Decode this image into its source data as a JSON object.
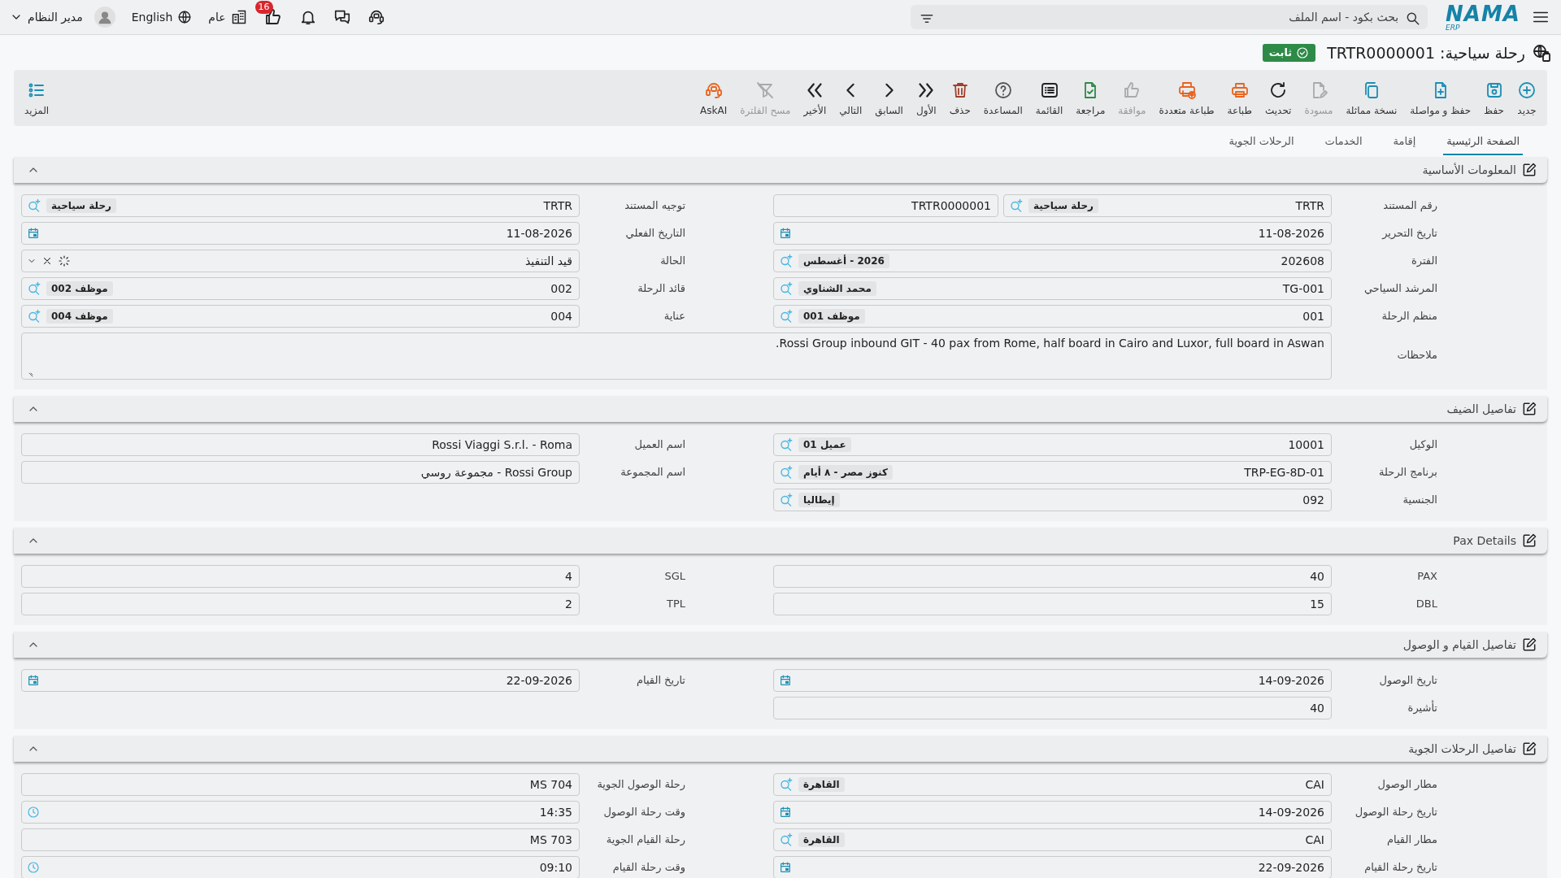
{
  "top_bar": {
    "logo": {
      "text": "NAMA",
      "sub": "ERP"
    },
    "search": {
      "placeholder": "بحث بكود - اسم الملف"
    },
    "approvals_count": "16",
    "branch": "عام",
    "language": "English",
    "user": "مدير النظام"
  },
  "document": {
    "title": "رحلة سياحية: TRTR0000001",
    "status": "ثابت"
  },
  "toolbar": {
    "buttons": [
      {
        "label": "جديد",
        "disabled": false
      },
      {
        "label": "حفظ",
        "disabled": false
      },
      {
        "label": "حفظ و مواصلة",
        "disabled": false
      },
      {
        "label": "نسخة مماثلة",
        "disabled": false
      },
      {
        "label": "مسودة",
        "disabled": true
      },
      {
        "label": "تحديث",
        "disabled": false
      },
      {
        "label": "طباعة",
        "disabled": false
      },
      {
        "label": "طباعة متعددة",
        "disabled": false
      },
      {
        "label": "موافقة",
        "disabled": true
      },
      {
        "label": "مراجعة",
        "disabled": false
      },
      {
        "label": "القائمة",
        "disabled": false
      },
      {
        "label": "المساعدة",
        "disabled": false
      },
      {
        "label": "حذف",
        "disabled": false
      },
      {
        "label": "الأول",
        "disabled": false
      },
      {
        "label": "السابق",
        "disabled": false
      },
      {
        "label": "التالي",
        "disabled": false
      },
      {
        "label": "الأخير",
        "disabled": false
      },
      {
        "label": "مسح الفلترة",
        "disabled": true
      },
      {
        "label": "AskAI",
        "disabled": false
      }
    ],
    "more": "المزيد"
  },
  "tabs": [
    {
      "label": "الصفحة الرئيسية",
      "selected": true
    },
    {
      "label": "إقامة",
      "selected": false
    },
    {
      "label": "الخدمات",
      "selected": false
    },
    {
      "label": "الرحلات الجوية",
      "selected": false
    }
  ],
  "sections": [
    {
      "title": "المعلومات الأساسية",
      "expanded": true,
      "rows": [
        [
          {
            "label": "رقم المستند",
            "kind": "serial",
            "value": "TRTR",
            "tag": "رحلة سياحية",
            "number": "TRTR0000001"
          },
          {
            "label": "توجيه المستند",
            "kind": "lookup",
            "value": "TRTR",
            "tag": "رحلة سياحية"
          }
        ],
        [
          {
            "label": "تاريخ التحرير",
            "kind": "date",
            "value": "11-08-2026"
          },
          {
            "label": "التاريخ الفعلي",
            "kind": "date",
            "value": "11-08-2026"
          }
        ],
        [
          {
            "label": "الفترة",
            "kind": "lookup",
            "value": "202608",
            "tag": "2026 - أغسطس"
          },
          {
            "label": "الحالة",
            "kind": "select",
            "value": "قيد التنفيذ"
          }
        ],
        [
          {
            "label": "المرشد السياحي",
            "kind": "lookup",
            "value": "TG-001",
            "tag": "محمد الشناوي"
          },
          {
            "label": "قائد الرحلة",
            "kind": "lookup",
            "value": "002",
            "tag": "موظف 002"
          }
        ],
        [
          {
            "label": "منظم الرحلة",
            "kind": "lookup",
            "value": "001",
            "tag": "موظف 001"
          },
          {
            "label": "عناية",
            "kind": "lookup",
            "value": "004",
            "tag": "موظف 004"
          }
        ],
        [
          {
            "label": "ملاحظات",
            "kind": "notes",
            "value": "Rossi Group inbound GIT - 40 pax from Rome, half board in Cairo and Luxor, full board in Aswan."
          }
        ]
      ]
    },
    {
      "title": "تفاصيل الضيف",
      "expanded": true,
      "rows": [
        [
          {
            "label": "الوكيل",
            "kind": "lookup",
            "value": "10001",
            "tag": "عميل 01"
          },
          {
            "label": "اسم العميل",
            "kind": "text",
            "value": "Rossi Viaggi S.r.l. - Roma"
          }
        ],
        [
          {
            "label": "برنامج الرحلة",
            "kind": "lookup",
            "value": "TRP-EG-8D-01",
            "tag": "كنوز مصر - ٨ أيام"
          },
          {
            "label": "اسم المجموعة",
            "kind": "text",
            "value": "Rossi Group - مجموعة روسي"
          }
        ],
        [
          {
            "label": "الجنسية",
            "kind": "lookup",
            "value": "092",
            "tag": "إيطاليا"
          }
        ]
      ]
    },
    {
      "title": "Pax Details",
      "expanded": true,
      "rows": [
        [
          {
            "label": "PAX",
            "kind": "text",
            "value": "40"
          },
          {
            "label": "SGL",
            "kind": "text",
            "value": "4"
          }
        ],
        [
          {
            "label": "DBL",
            "kind": "text",
            "value": "15"
          },
          {
            "label": "TPL",
            "kind": "text",
            "value": "2"
          }
        ]
      ]
    },
    {
      "title": "تفاصيل القيام و الوصول",
      "expanded": true,
      "rows": [
        [
          {
            "label": "تاريخ الوصول",
            "kind": "date",
            "value": "14-09-2026"
          },
          {
            "label": "تاريخ القيام",
            "kind": "date",
            "value": "22-09-2026"
          }
        ],
        [
          {
            "label": "تأشيرة",
            "kind": "text",
            "value": "40"
          }
        ]
      ]
    },
    {
      "title": "تفاصيل الرحلات الجوية",
      "expanded": true,
      "rows": [
        [
          {
            "label": "مطار الوصول",
            "kind": "lookup",
            "value": "CAI",
            "tag": "القاهرة"
          },
          {
            "label": "رحلة الوصول الجوية",
            "kind": "text",
            "value": "MS 704"
          }
        ],
        [
          {
            "label": "تاريخ رحلة الوصول",
            "kind": "date",
            "value": "14-09-2026"
          },
          {
            "label": "وقت رحلة الوصول",
            "kind": "time",
            "value": "14:35"
          }
        ],
        [
          {
            "label": "مطار القيام",
            "kind": "lookup",
            "value": "CAI",
            "tag": "القاهرة"
          },
          {
            "label": "رحلة القيام الجوية",
            "kind": "text",
            "value": "MS 703"
          }
        ],
        [
          {
            "label": "تاريخ رحلة القيام",
            "kind": "date",
            "value": "22-09-2026"
          },
          {
            "label": "وقت رحلة القيام",
            "kind": "time",
            "value": "09:10"
          }
        ]
      ]
    }
  ]
}
